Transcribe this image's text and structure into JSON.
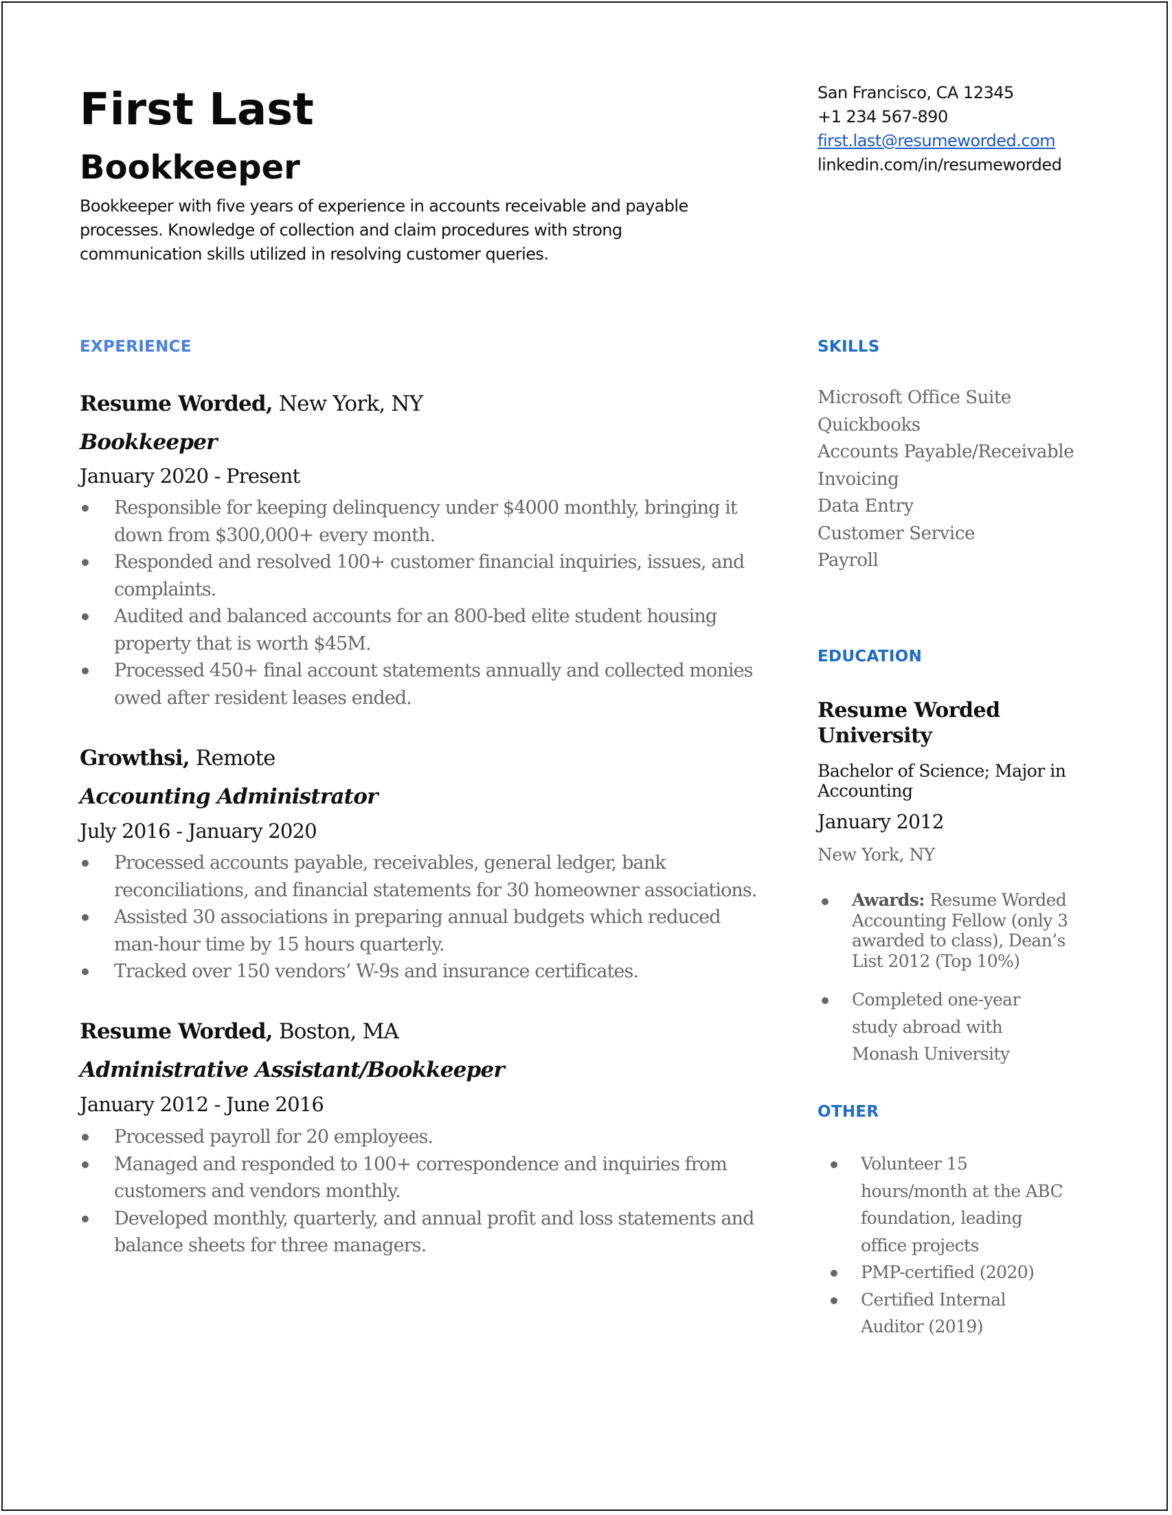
{
  "header": {
    "name": "First Last",
    "headline": "Bookkeeper",
    "summary_lines": [
      "Bookkeeper with five years of experience in accounts receivable and payable",
      "processes. Knowledge of collection and claim procedures with strong",
      "communication skills utilized in resolving customer queries."
    ]
  },
  "contact": {
    "location": "San Francisco, CA 12345",
    "phone": "+1 234 567-890",
    "email": "first.last@resumeworded.com",
    "linkedin": "linkedin.com/in/resumeworded"
  },
  "colors": {
    "experience_heading": "#4a7fe0",
    "sidebar_heading": "#1f6bc9",
    "email_link": "#1a55c8",
    "body_gray": "#666666"
  },
  "experience": {
    "heading": "EXPERIENCE",
    "jobs": [
      {
        "company": "Resume Worded,",
        "location": " New York, NY",
        "title": "Bookkeeper",
        "dates": "January 2020 - Present",
        "bullets": [
          [
            "Responsible for keeping delinquency under $4000 monthly, bringing it",
            "down from $300,000+ every month."
          ],
          [
            "Responded and resolved 100+ customer financial inquiries, issues, and",
            "complaints."
          ],
          [
            "Audited and balanced accounts for an 800-bed elite student housing",
            "property that is worth $45M."
          ],
          [
            "Processed 450+ final account statements annually and collected monies",
            "owed after resident leases ended."
          ]
        ]
      },
      {
        "company": "Growthsi,",
        "location": " Remote",
        "title": "Accounting Administrator",
        "dates": "July 2016 - January 2020",
        "bullets": [
          [
            "Processed accounts payable, receivables, general ledger, bank",
            "reconciliations, and financial statements for 30 homeowner associations."
          ],
          [
            "Assisted 30 associations in preparing annual budgets which reduced",
            "man-hour time by 15 hours quarterly."
          ],
          [
            "Tracked over 150 vendors’ W-9s and insurance certificates."
          ]
        ]
      },
      {
        "company": "Resume Worded,",
        "location": " Boston, MA",
        "title": "Administrative Assistant/Bookkeeper",
        "dates": "January 2012 - June 2016",
        "bullets": [
          [
            "Processed payroll for 20 employees."
          ],
          [
            "Managed and responded to 100+ correspondence and inquiries from",
            "customers and vendors monthly."
          ],
          [
            "Developed monthly, quarterly, and annual profit and loss statements and",
            "balance sheets for three managers."
          ]
        ]
      }
    ]
  },
  "skills": {
    "heading": "SKILLS",
    "items": [
      "Microsoft Office Suite",
      "Quickbooks",
      "Accounts Payable/Receivable",
      "Invoicing",
      "Data Entry",
      "Customer Service",
      "Payroll"
    ]
  },
  "education": {
    "heading": "EDUCATION",
    "school_lines": [
      "Resume Worded",
      "University"
    ],
    "degree_lines": [
      "Bachelor of Science; Major in",
      "Accounting"
    ],
    "date": "January 2012",
    "location": "New York, NY",
    "awards_label": "Awards:",
    "awards_lines": [
      " Resume Worded",
      "Accounting Fellow (only 3",
      "awarded to class), Dean’s",
      "List 2012 (Top 10%)"
    ],
    "extra_lines": [
      "Completed one-year",
      "study abroad with",
      "Monash University"
    ]
  },
  "other": {
    "heading": "OTHER",
    "items": [
      [
        "Volunteer 15",
        "hours/month at the ABC",
        "foundation, leading",
        "office projects"
      ],
      [
        "PMP-certified (2020)"
      ],
      [
        "Certified Internal",
        "Auditor (2019)"
      ]
    ]
  }
}
